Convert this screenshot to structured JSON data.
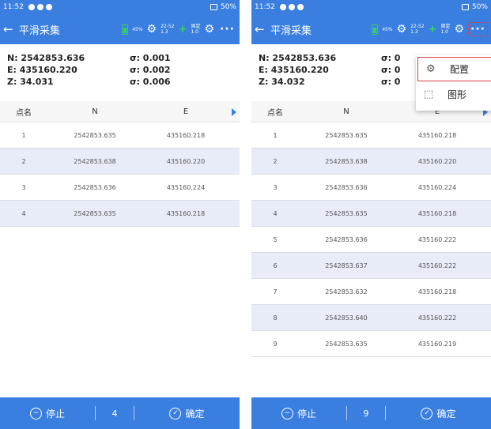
{
  "screens": [
    {
      "status": {
        "time": "11:52",
        "battery_text": "50%"
      },
      "header": {
        "back": "←",
        "title": "平滑采集",
        "battery_percent": "45%",
        "sat_top": "22-52",
        "sat_bottom": "1.3",
        "fix_top": "固定",
        "fix_bottom": "1.0",
        "more": "···"
      },
      "coords": {
        "n": "N: 2542853.636",
        "sn": "σ: 0.001",
        "e": "E: 435160.220",
        "se": "σ: 0.002",
        "z": "Z: 34.031",
        "sz": "σ: 0.006"
      },
      "table": {
        "headers": [
          "点名",
          "N",
          "E"
        ],
        "rows": [
          [
            "1",
            "2542853.635",
            "435160.218"
          ],
          [
            "2",
            "2542853.638",
            "435160.220"
          ],
          [
            "3",
            "2542853.636",
            "435160.224"
          ],
          [
            "4",
            "2542853.635",
            "435160.218"
          ]
        ]
      },
      "bottom": {
        "stop": "停止",
        "count": "4",
        "ok": "确定"
      }
    },
    {
      "status": {
        "time": "11:52",
        "battery_text": "50%"
      },
      "header": {
        "back": "←",
        "title": "平滑采集",
        "battery_percent": "45%",
        "sat_top": "22-52",
        "sat_bottom": "1.3",
        "fix_top": "固定",
        "fix_bottom": "1.0",
        "more": "···"
      },
      "coords": {
        "n": "N: 2542853.636",
        "sn": "σ: 0",
        "e": "E: 435160.220",
        "se": "σ: 0",
        "z": "Z: 34.032",
        "sz": "σ: 0"
      },
      "table": {
        "headers": [
          "点名",
          "N",
          "E"
        ],
        "rows": [
          [
            "1",
            "2542853.635",
            "435160.218"
          ],
          [
            "2",
            "2542853.638",
            "435160.220"
          ],
          [
            "3",
            "2542853.636",
            "435160.224"
          ],
          [
            "4",
            "2542853.635",
            "435160.218"
          ],
          [
            "5",
            "2542853.636",
            "435160.222"
          ],
          [
            "6",
            "2542853.637",
            "435160.222"
          ],
          [
            "7",
            "2542853.632",
            "435160.218"
          ],
          [
            "8",
            "2542853.640",
            "435160.222"
          ],
          [
            "9",
            "2542853.635",
            "435160.219"
          ]
        ]
      },
      "menu": {
        "item1": "配置",
        "item2": "图形"
      },
      "bottom": {
        "stop": "停止",
        "count": "9",
        "ok": "确定"
      }
    }
  ],
  "colors": {
    "primary": "#3a7fe0",
    "alt_row": "#e7ecf8",
    "highlight": "#e03c3c",
    "green": "#37d45a"
  },
  "icons": [
    "back-arrow-icon",
    "battery-icon",
    "satellite-icon",
    "fix-icon",
    "more-icon",
    "stop-icon",
    "check-icon",
    "gear-icon",
    "shape-icon",
    "arrow-right-icon"
  ]
}
